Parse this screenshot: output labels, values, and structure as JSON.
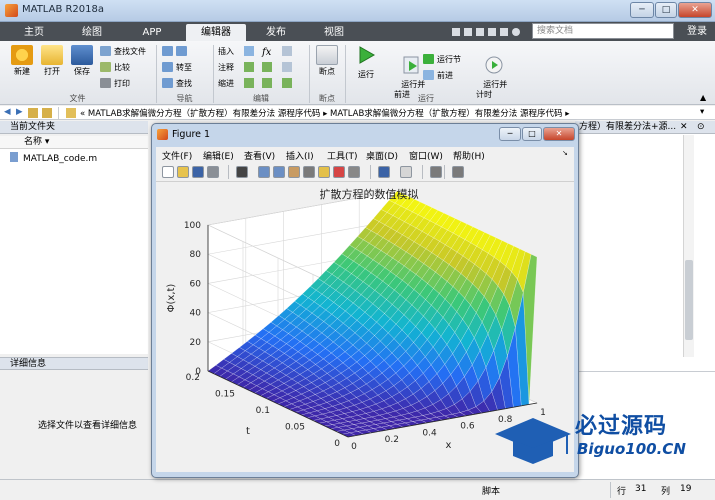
{
  "window": {
    "title": "MATLAB R2018a",
    "controls": [
      "─",
      "□",
      "✕"
    ]
  },
  "tabs": [
    {
      "label": "主页"
    },
    {
      "label": "绘图"
    },
    {
      "label": "APP"
    },
    {
      "label": "编辑器",
      "active": true
    },
    {
      "label": "发布"
    },
    {
      "label": "视图"
    }
  ],
  "search": {
    "placeholder": "搜索文档"
  },
  "login": "登录",
  "ribbon": {
    "file": {
      "group": "文件",
      "new": "新建",
      "open": "打开",
      "save": "保存",
      "find_files": "查找文件",
      "compare": "比较",
      "print": "打印"
    },
    "navigate": {
      "group": "导航",
      "goto": "转至",
      "find": "查找"
    },
    "edit": {
      "group": "编辑",
      "insert": "插入",
      "comment": "注释",
      "indent": "缩进"
    },
    "breakpoints": {
      "group": "断点",
      "label": "断点"
    },
    "run": {
      "group": "运行",
      "run": "运行",
      "run_advance": "运行并\n前进",
      "run_section": "运行节",
      "advance": "前进",
      "run_time": "运行并\n计时"
    }
  },
  "address": {
    "path": "« MATLAB求解偏微分方程（扩散方程）有限差分法 源程序代码 ▸ MATLAB求解偏微分方程（扩散方程）有限差分法 源程序代码 ▸"
  },
  "left": {
    "current_folder": "当前文件夹",
    "col_name": "名称 ▾",
    "files": [
      {
        "name": "MATLAB_code.m"
      }
    ],
    "details_header": "详细信息",
    "details_msg": "选择文件以查看详细信息"
  },
  "right": {
    "header": "方程）有限差分法+源..."
  },
  "status": {
    "script": "脚本",
    "row_label": "行",
    "row": "31",
    "col_label": "列",
    "col": "19"
  },
  "figure": {
    "title": "Figure 1",
    "menu": [
      "文件(F)",
      "编辑(E)",
      "查看(V)",
      "插入(I)",
      "工具(T)",
      "桌面(D)",
      "窗口(W)",
      "帮助(H)"
    ],
    "tools": [
      "new-icon",
      "open-icon",
      "save-icon",
      "print-icon",
      "pointer-icon",
      "zoom-in-icon",
      "zoom-out-icon",
      "pan-icon",
      "rotate-icon",
      "datacursor-icon",
      "brush-icon",
      "link-icon",
      "colorbar-icon",
      "legend-icon",
      "hide-icon",
      "dock-icon"
    ]
  },
  "chart_data": {
    "type": "surface",
    "title": "扩散方程的数值模拟",
    "zlabel": "Φ(x,t)",
    "xlabel": "x",
    "ylabel": "t",
    "zlim": [
      0,
      100
    ],
    "z_ticks": [
      0,
      20,
      40,
      60,
      80,
      100
    ],
    "t_ticks": [
      0,
      0.05,
      0.1,
      0.15,
      0.2
    ],
    "x_ticks": [
      0,
      0.2,
      0.4,
      0.6,
      0.8,
      1
    ],
    "x_range": [
      0,
      1
    ],
    "t_range": [
      0,
      0.2
    ],
    "boundary": {
      "phi_at_x0": 0,
      "phi_at_x1": 100
    },
    "colormap": "parula",
    "grid": true
  },
  "watermark": {
    "brand": "必过源码",
    "url": "Biguo100.CN"
  },
  "colors": {
    "ribbon_dark": "#4a4f55",
    "accent_yellow": "#f9fb0e",
    "accent_blue": "#3e26a8",
    "brand_red": "#e0262a"
  }
}
